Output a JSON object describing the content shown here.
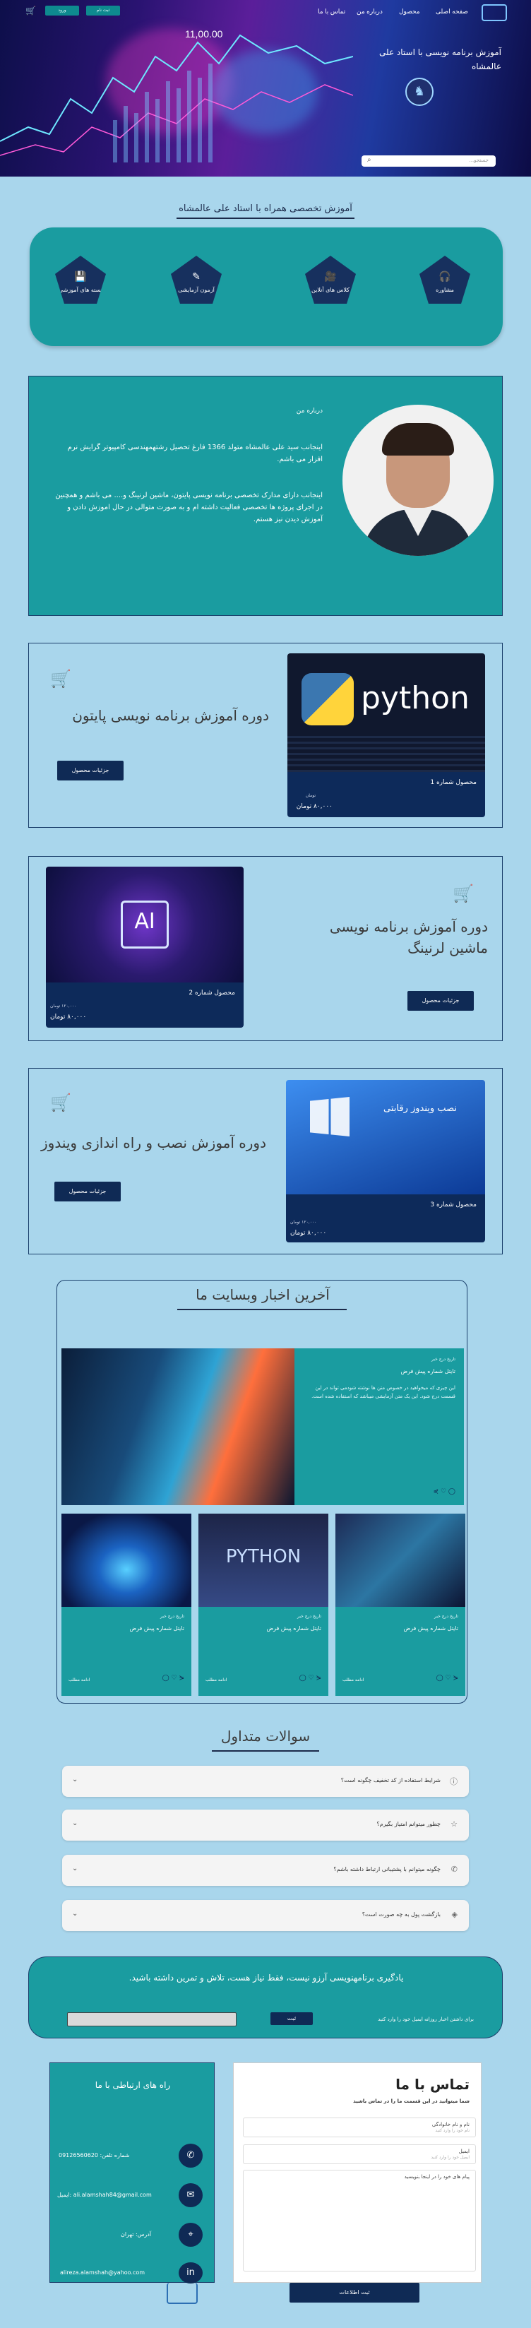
{
  "header": {
    "nav": [
      "صفحه اصلی",
      "محصول",
      "درباره من",
      "تماس با ما"
    ],
    "btn_login": "ورود",
    "btn_register": "ثبت نام",
    "hero_title": "آموزش برنامه نویسی با استاد علی عالمشاه",
    "hero_number": "11,00.00",
    "search_placeholder": "جستجو..."
  },
  "services": {
    "title": "آموزش تخصصی همراه با استاد علی عالمشاه",
    "items": [
      {
        "label": "مشاوره",
        "icon": "headphones-icon",
        "glyph": "🎧"
      },
      {
        "label": "کلاس های آنلاین",
        "icon": "video-icon",
        "glyph": "🎥"
      },
      {
        "label": "آزمون آزمایشی",
        "icon": "edit-icon",
        "glyph": "✎"
      },
      {
        "label": "بسته های آموزشی",
        "icon": "save-icon",
        "glyph": "💾"
      }
    ]
  },
  "about": {
    "heading": "درباره من",
    "p1": "اینجانب سید علی عالمشاه متولد 1366 فارغ تحصیل رشتهمهندسی کامپیوتر گرایش نرم افزار می باشم.",
    "p2": "اینجانب دارای مدارک تخصصی برنامه نویسی پایتون، ماشین لرنینگ و.... می باشم و همچنین در اجرای پروژه ها تخصصی فعالیت داشته ام و به صورت متوالی در حال اموزش دادن و آموزش دیدن نیز هستم."
  },
  "products": [
    {
      "title": "دوره آموزش برنامه نویسی پایتون",
      "label": "محصول شماره 1",
      "old": "تومان",
      "price": "۸۰,۰۰۰ تومان",
      "btn": "جزئیات محصول",
      "img_text": "python"
    },
    {
      "title": "دوره آموزش برنامه نویسی ماشین لرنینگ",
      "label": "محصول شماره 2",
      "old": "۱۲۰,۰۰۰ تومان",
      "price": "۸۰,۰۰۰ تومان",
      "btn": "جزئیات محصول",
      "img_text": "AI"
    },
    {
      "title": "دوره آموزش نصب و راه اندازی ویندوز",
      "label": "محصول شماره 3",
      "old": "۱۲۰,۰۰۰ تومان",
      "price": "۸۰,۰۰۰ تومان",
      "btn": "جزئیات محصول",
      "img_text": "نصب ویندوز رقابتی"
    }
  ],
  "news": {
    "title": "آخرین اخبار وبسایت ما",
    "featured": {
      "date": "تاریخ درج خبر",
      "title": "تایتل شماره پیش فرض",
      "body": "این چیزی که میخواهید در خصوص متن ها نوشته شودمی تواند در این قسمت درج شود. این یک متن آزمایشی میباشد که استفاده شده است."
    },
    "cards": [
      {
        "date": "تاریخ درج خبر",
        "title": "تایتل شماره پیش فرض",
        "more": "ادامه مطلب"
      },
      {
        "date": "تاریخ درج خبر",
        "title": "تایتل شماره پیش فرض",
        "more": "ادامه مطلب"
      },
      {
        "date": "تاریخ درج خبر",
        "title": "تایتل شماره پیش فرض",
        "more": "ادامه مطلب"
      }
    ]
  },
  "faq": {
    "title": "سوالات متداول",
    "items": [
      "شرایط استفاده از کد تخفیف چگونه است؟",
      "چطور میتوانم امتیاز بگیرم؟",
      "چگونه میتوانم با پشتیبانی ارتباط داشته باشم؟",
      "بازگشت پول به چه صورت است؟"
    ]
  },
  "newsletter": {
    "text": "یادگیری برنامهنویسی آرزو نیست، فقط نیاز هست، تلاش و تمرین داشته باشید.",
    "sub": "برای داشتن اخبار روزانه ایمیل خود را وارد کنید",
    "btn": "ثبت"
  },
  "contact": {
    "side_title": "راه های ارتباطی با ما",
    "phone": "شماره تلفن: 09126560620",
    "email": "ایمیل: ali.alamshah84@gmail.com",
    "address": "آدرس: تهران",
    "linkedin": "alireza.alamshah@yahoo.com",
    "form_title": "تماس با ما",
    "form_sub": "شما میتوانید در این قسمت ما را در تماس باشید",
    "name_label": "نام و نام خانوادگی",
    "name_ph": "نام خود را وارد کنید",
    "email_label": "ایمیل",
    "email_ph": "ایمیل خود را وارد کنید",
    "msg_label": "پیام های خود را در اینجا بنویسید",
    "submit": "ثبت اطلاعات"
  }
}
